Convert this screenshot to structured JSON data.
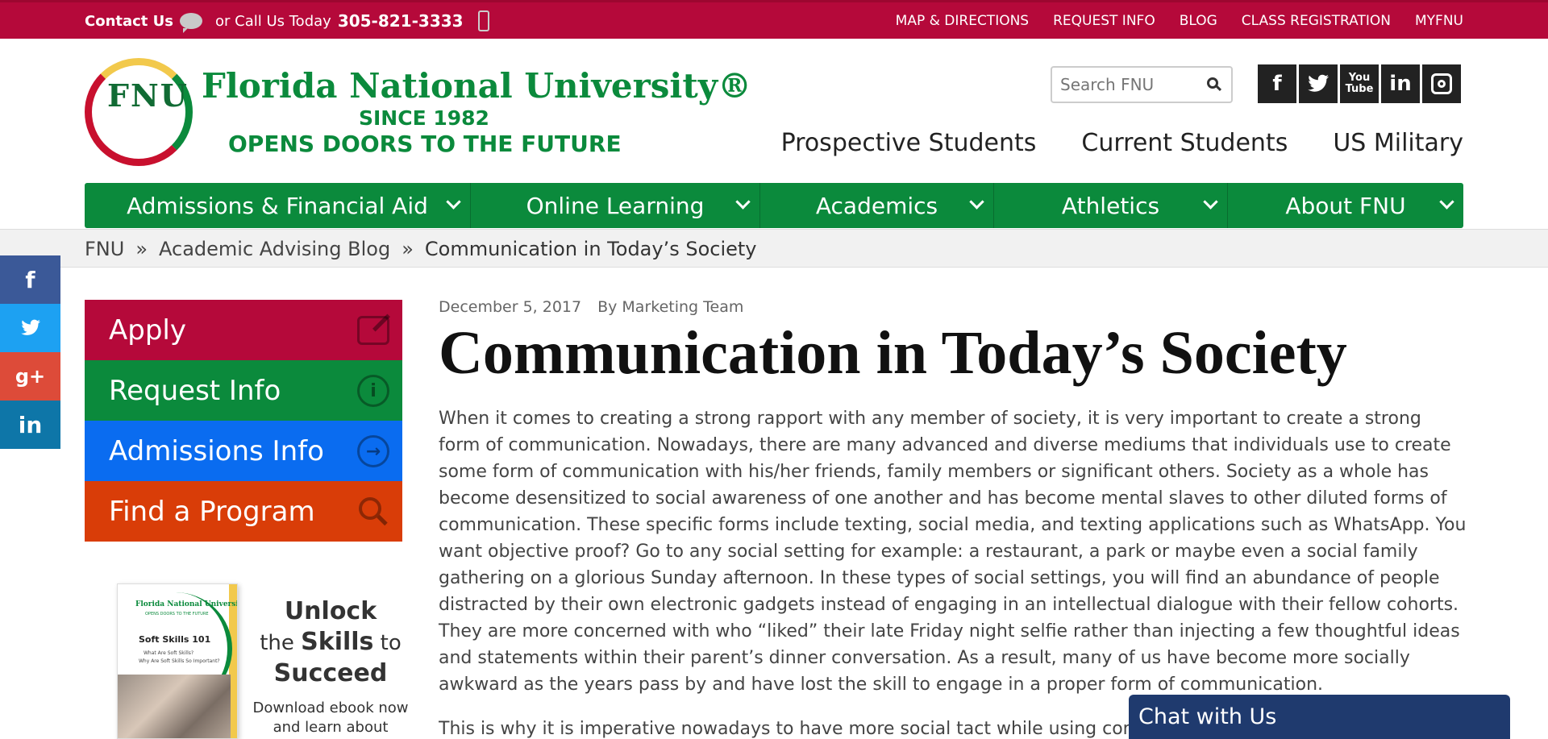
{
  "topbar": {
    "contact_label": "Contact Us",
    "call_label": "or Call Us Today",
    "phone": "305-821-3333",
    "links": [
      "MAP & DIRECTIONS",
      "REQUEST INFO",
      "BLOG",
      "CLASS REGISTRATION",
      "MYFNU"
    ]
  },
  "logo": {
    "letters": "FNU",
    "name": "Florida National University®",
    "since": "SINCE 1982",
    "tagline": "OPENS DOORS TO THE FUTURE"
  },
  "search": {
    "placeholder": "Search FNU"
  },
  "social": {
    "youtube_label": "You Tube"
  },
  "audience_links": [
    "Prospective Students",
    "Current Students",
    "US Military"
  ],
  "main_nav": [
    "Admissions & Financial Aid",
    "Online Learning",
    "Academics",
    "Athletics",
    "About FNU"
  ],
  "breadcrumb": {
    "items": [
      "FNU",
      "Academic Advising Blog",
      "Communication in Today’s Society"
    ],
    "separator": "»"
  },
  "sidebar": {
    "ctas": [
      {
        "label": "Apply",
        "color": "#b5093a"
      },
      {
        "label": "Request Info",
        "color": "#0b8a3c"
      },
      {
        "label": "Admissions Info",
        "color": "#0a6cf0"
      },
      {
        "label": "Find a Program",
        "color": "#d93d08"
      }
    ],
    "ebook": {
      "brand": "Florida National University",
      "tag": "OPENS DOORS TO THE FUTURE",
      "title": "Soft Skills 101",
      "subtitle": "What Are Soft Skills?",
      "subtitle2": "Why Are Soft Skills So Important?"
    },
    "promo": {
      "line1": "Unlock",
      "line2_pre": "the",
      "line2_bold": "Skills",
      "line2_post": "to",
      "line3": "Succeed",
      "line4": "Download ebook now and learn about"
    }
  },
  "article": {
    "date": "December 5, 2017",
    "author": "By Marketing Team",
    "title": "Communication in Today’s Society",
    "paragraph1": "When it comes to creating a strong rapport with any member of society, it is very important to create a strong form of communication. Nowadays, there are many advanced and diverse mediums that individuals use to create some form of communication with his/her friends, family members or significant others. Society as a whole has become desensitized to social awareness of one another and has become mental slaves to other diluted forms of communication. These specific forms include texting, social media, and texting applications such as WhatsApp. You want objective proof? Go to any social setting for example: a restaurant, a park or maybe even a social family gathering on a glorious Sunday afternoon. In these types of social settings, you will find an abundance of people distracted by their own electronic gadgets instead of engaging in an intellectual dialogue with their fellow cohorts. They are more concerned with who “liked” their late Friday night selfie rather than injecting a few thoughtful ideas and statements within their parent’s dinner conversation. As a result, many of us have become more socially awkward as the years pass by and have lost the skill to engage in a proper form of communication.",
    "paragraph2": "This is why it is imperative nowadays to have more social tact while using commun"
  },
  "chat": {
    "label": "Chat with Us"
  },
  "colors": {
    "brand_red": "#b5093a",
    "brand_green": "#0b8a3c",
    "chat_navy": "#1f3a6e",
    "facebook": "#3b5998",
    "twitter": "#1da1f2",
    "googleplus": "#dd4b39",
    "linkedin": "#0e76a8"
  }
}
